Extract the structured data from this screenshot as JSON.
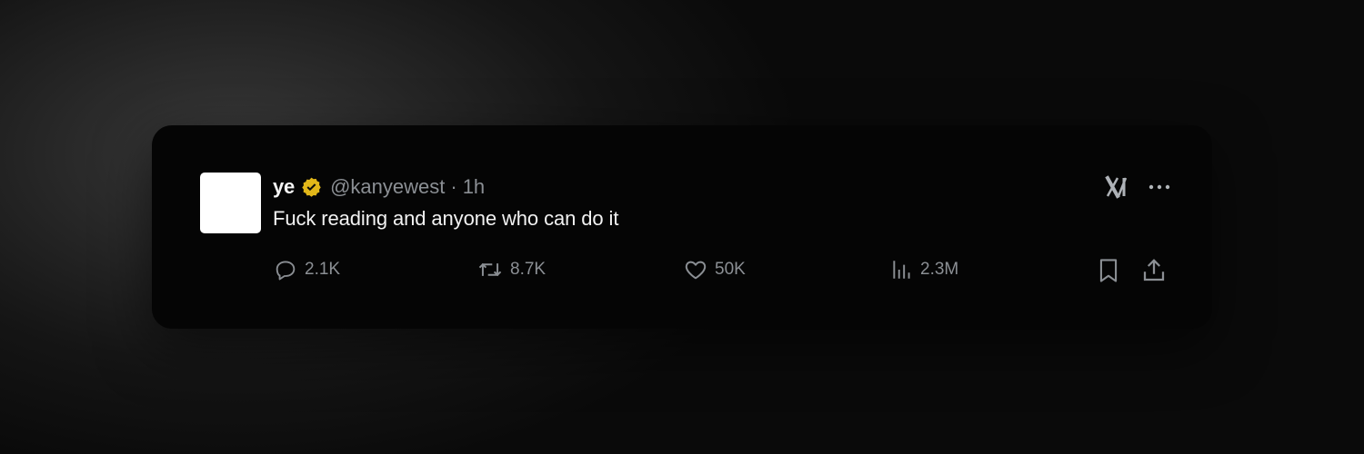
{
  "colors": {
    "page_background": "#0a0a0a",
    "card_background": "#050505",
    "muted_text": "#8b8f94",
    "text": "#f2f2f2",
    "verified_gold": "#e2b719"
  },
  "tweet": {
    "display_name": "ye",
    "verified_icon": "verified-badge-icon",
    "handle": "@kanyewest",
    "separator": "·",
    "time": "1h",
    "text": "Fuck reading and anyone who can do it"
  },
  "top_actions": {
    "logo_icon": "x-logo-icon",
    "more_icon": "more-icon"
  },
  "stats": {
    "replies": "2.1K",
    "retweets": "8.7K",
    "likes": "50K",
    "views": "2.3M"
  },
  "icons": {
    "reply": "reply-icon",
    "retweet": "retweet-icon",
    "like": "heart-icon",
    "views": "views-icon",
    "bookmark": "bookmark-icon",
    "share": "share-icon"
  }
}
